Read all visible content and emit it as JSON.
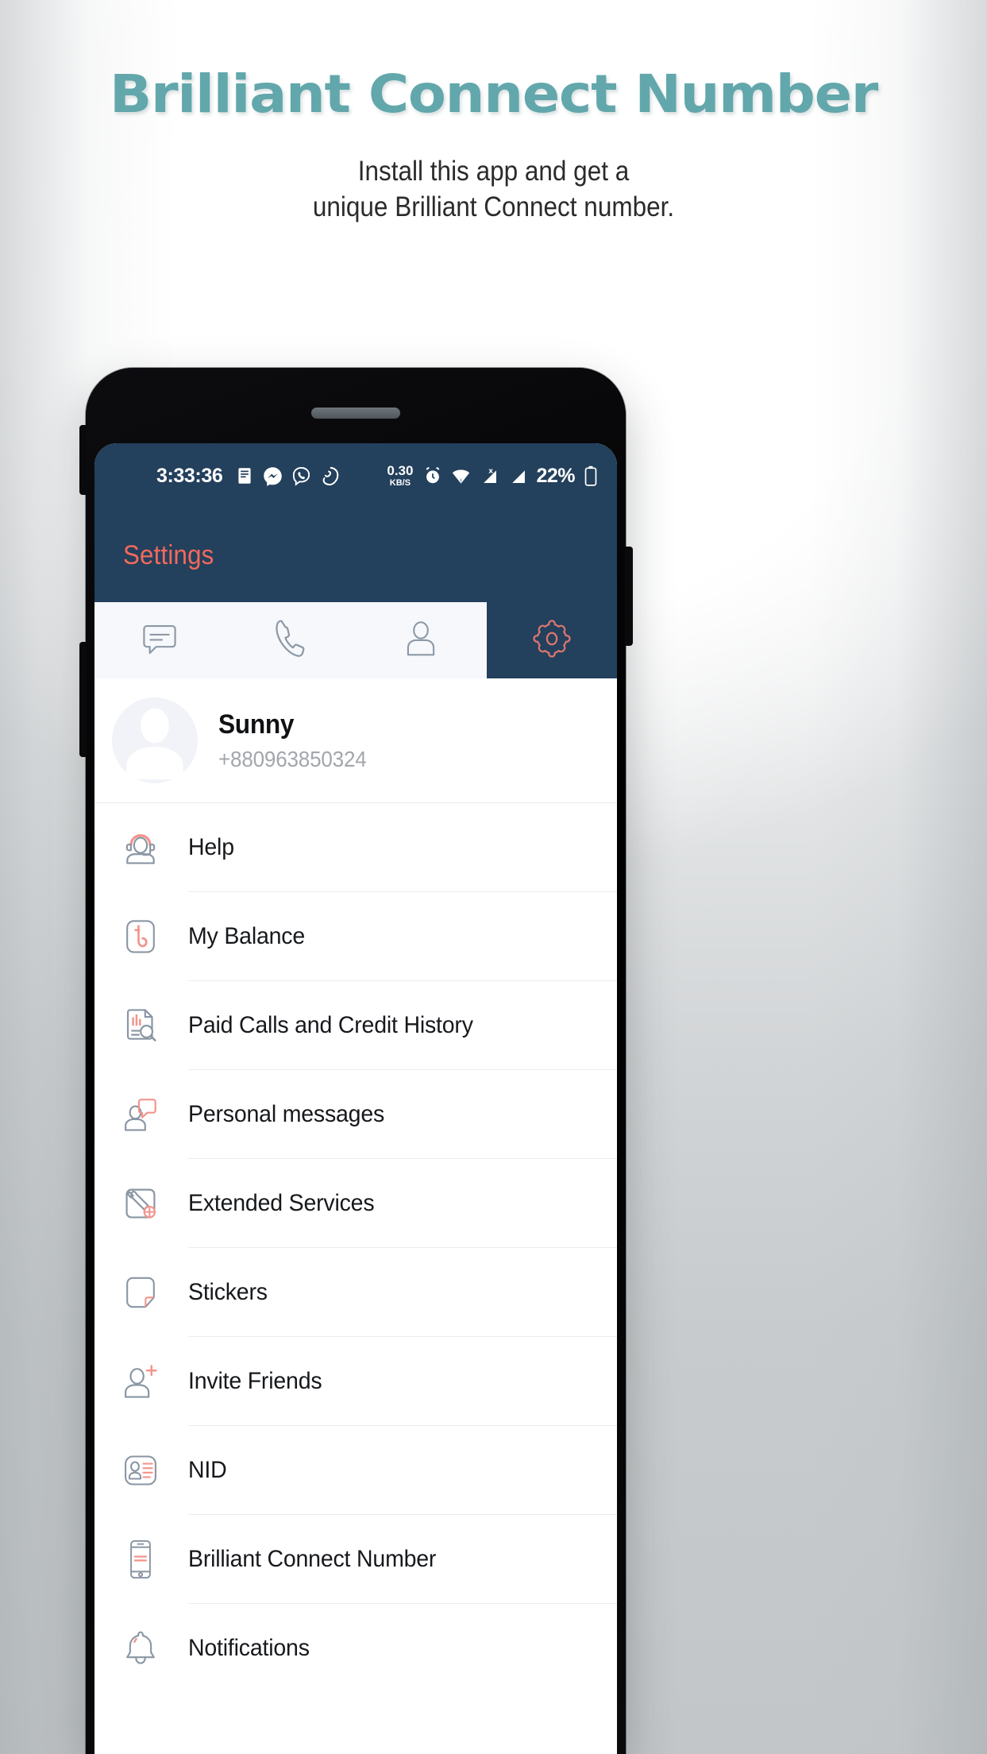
{
  "poster": {
    "title": "Brilliant Connect Number",
    "subtitle_line1": "Install this app and get a",
    "subtitle_line2": "unique Brilliant Connect number.",
    "title_color": "#62a7ab",
    "subtitle_color": "#2b2b2b"
  },
  "phone": {
    "frame_color": "#070709",
    "speaker_icon": "speaker-grille"
  },
  "screen": {
    "statusbar": {
      "clock": "3:33:36",
      "notification_icons": [
        "document-notification-icon",
        "messenger-icon",
        "viber-icon",
        "imo-icon"
      ],
      "network_speed_value": "0.30",
      "network_speed_unit": "KB/S",
      "status_icons": [
        "alarm-icon",
        "wifi-icon",
        "signal-sim1-icon",
        "signal-sim2-icon"
      ],
      "battery_percent": "22%",
      "battery_icon": "battery-icon",
      "background_color": "#23405c",
      "text_color": "#ffffff"
    },
    "appbar": {
      "title": "Settings",
      "title_color": "#f2695c",
      "background_color": "#23405c"
    },
    "tabs": [
      {
        "name": "chats",
        "icon": "chat-bubble-icon",
        "active": false
      },
      {
        "name": "calls",
        "icon": "phone-handset-icon",
        "active": false
      },
      {
        "name": "contacts",
        "icon": "person-icon",
        "active": false
      },
      {
        "name": "settings",
        "icon": "gear-icon",
        "active": true
      }
    ],
    "tab_active_color": "#23405c",
    "tab_inactive_background": "#f6f8fb",
    "profile": {
      "avatar_icon": "default-avatar-icon",
      "name": "Sunny",
      "phone": "+880963850324"
    },
    "menu_items": [
      {
        "label": "Help",
        "icon": "support-headset-icon"
      },
      {
        "label": "My Balance",
        "icon": "taka-balance-icon"
      },
      {
        "label": "Paid Calls and Credit History",
        "icon": "document-search-icon"
      },
      {
        "label": "Personal messages",
        "icon": "person-message-icon"
      },
      {
        "label": "Extended Services",
        "icon": "wrench-settings-icon"
      },
      {
        "label": "Stickers",
        "icon": "sticker-icon"
      },
      {
        "label": "Invite Friends",
        "icon": "person-add-icon"
      },
      {
        "label": "NID",
        "icon": "id-card-icon"
      },
      {
        "label": "Brilliant Connect Number",
        "icon": "mobile-phone-icon"
      },
      {
        "label": "Notifications",
        "icon": "bell-icon"
      }
    ],
    "accent_color": "#f2948c",
    "icon_stroke_color": "#8a96a3"
  }
}
